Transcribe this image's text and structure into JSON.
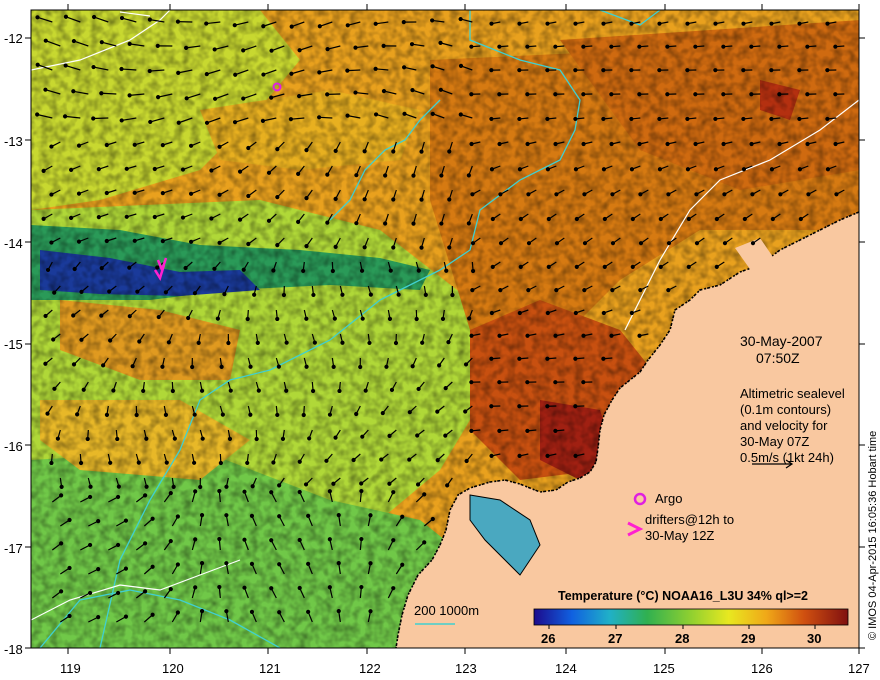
{
  "map": {
    "y_ticks": [
      "-12",
      "-13",
      "-14",
      "-15",
      "-16",
      "-17",
      "-18"
    ],
    "x_ticks": [
      "119",
      "120",
      "121",
      "122",
      "123",
      "124",
      "125",
      "126",
      "127"
    ],
    "colors": {
      "land": "#f9c8a0",
      "warm": "#e07f10",
      "hot": "#a02010",
      "mid": "#f0c020",
      "cool": "#a8e030",
      "cold": "#20a060",
      "coldest": "#102090",
      "contour_isobath": "#40d0d0",
      "contour_sealevel": "#ffffff",
      "argo": "#e020e0",
      "drifter": "#ff20d0"
    }
  },
  "annotations": {
    "date": "30-May-2007",
    "time": "07:50Z",
    "altimetry_lines": [
      "Altimetric sealevel",
      "(0.1m contours)",
      "and velocity for",
      "30-May 07Z",
      "0.5m/s (1kt 24h)"
    ],
    "argo_label": "Argo",
    "drifter_lines": [
      "drifters@12h to",
      "30-May 12Z"
    ],
    "isobath_label": "200  1000m"
  },
  "colorbar": {
    "title": "Temperature (°C) NOAA16_L3U 34% ql>=2",
    "ticks": [
      "26",
      "27",
      "28",
      "29",
      "30"
    ]
  },
  "credit": "© IMOS 04-Apr-2015 16:05:36 Hobart time"
}
